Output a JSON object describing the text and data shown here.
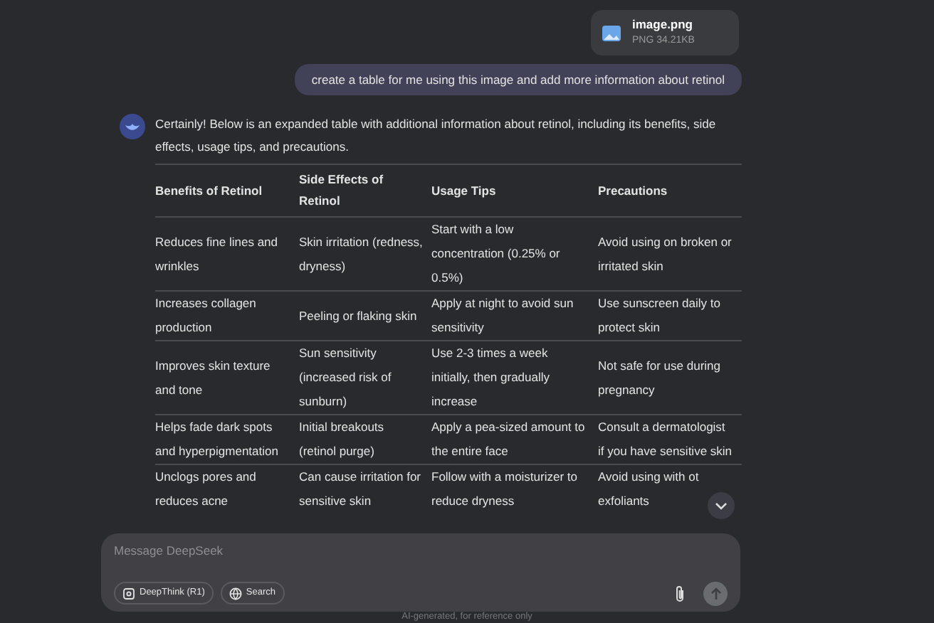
{
  "attachment": {
    "name": "image.png",
    "meta": "PNG 34.21KB"
  },
  "user_message": "create a table for me using this image and add more information about retinol",
  "reply": {
    "intro": "Certainly! Below is an expanded table with additional information about retinol, including its benefits, side effects, usage tips, and precautions.",
    "table": {
      "columns": [
        "Benefits of Retinol",
        "Side Effects of Retinol",
        "Usage Tips",
        "Precautions"
      ],
      "rows": [
        [
          "Reduces fine lines and wrinkles",
          "Skin irritation (redness, dryness)",
          "Start with a low concentration (0.25% or 0.5%)",
          "Avoid using on broken or irritated skin"
        ],
        [
          "Increases collagen production",
          "Peeling or flaking skin",
          "Apply at night to avoid sun sensitivity",
          "Use sunscreen daily to protect skin"
        ],
        [
          "Improves skin texture and tone",
          "Sun sensitivity (increased risk of sunburn)",
          "Use 2-3 times a week initially, then gradually increase",
          "Not safe for use during pregnancy"
        ],
        [
          "Helps fade dark spots and hyperpigmentation",
          "Initial breakouts (retinol purge)",
          "Apply a pea-sized amount to the entire face",
          "Consult a dermatologist if you have sensitive skin"
        ],
        [
          "Unclogs pores and reduces acne",
          "Can cause irritation for sensitive skin",
          "Follow with a moisturizer to reduce dryness",
          "Avoid using with ot exfoliants"
        ]
      ]
    }
  },
  "composer": {
    "placeholder": "Message DeepSeek",
    "buttons": [
      {
        "kind": "deepthink",
        "label": "DeepThink (R1)",
        "selected": false
      },
      {
        "kind": "search",
        "label": "Search",
        "selected": false
      }
    ]
  },
  "footer": "AI-generated, for reference only"
}
